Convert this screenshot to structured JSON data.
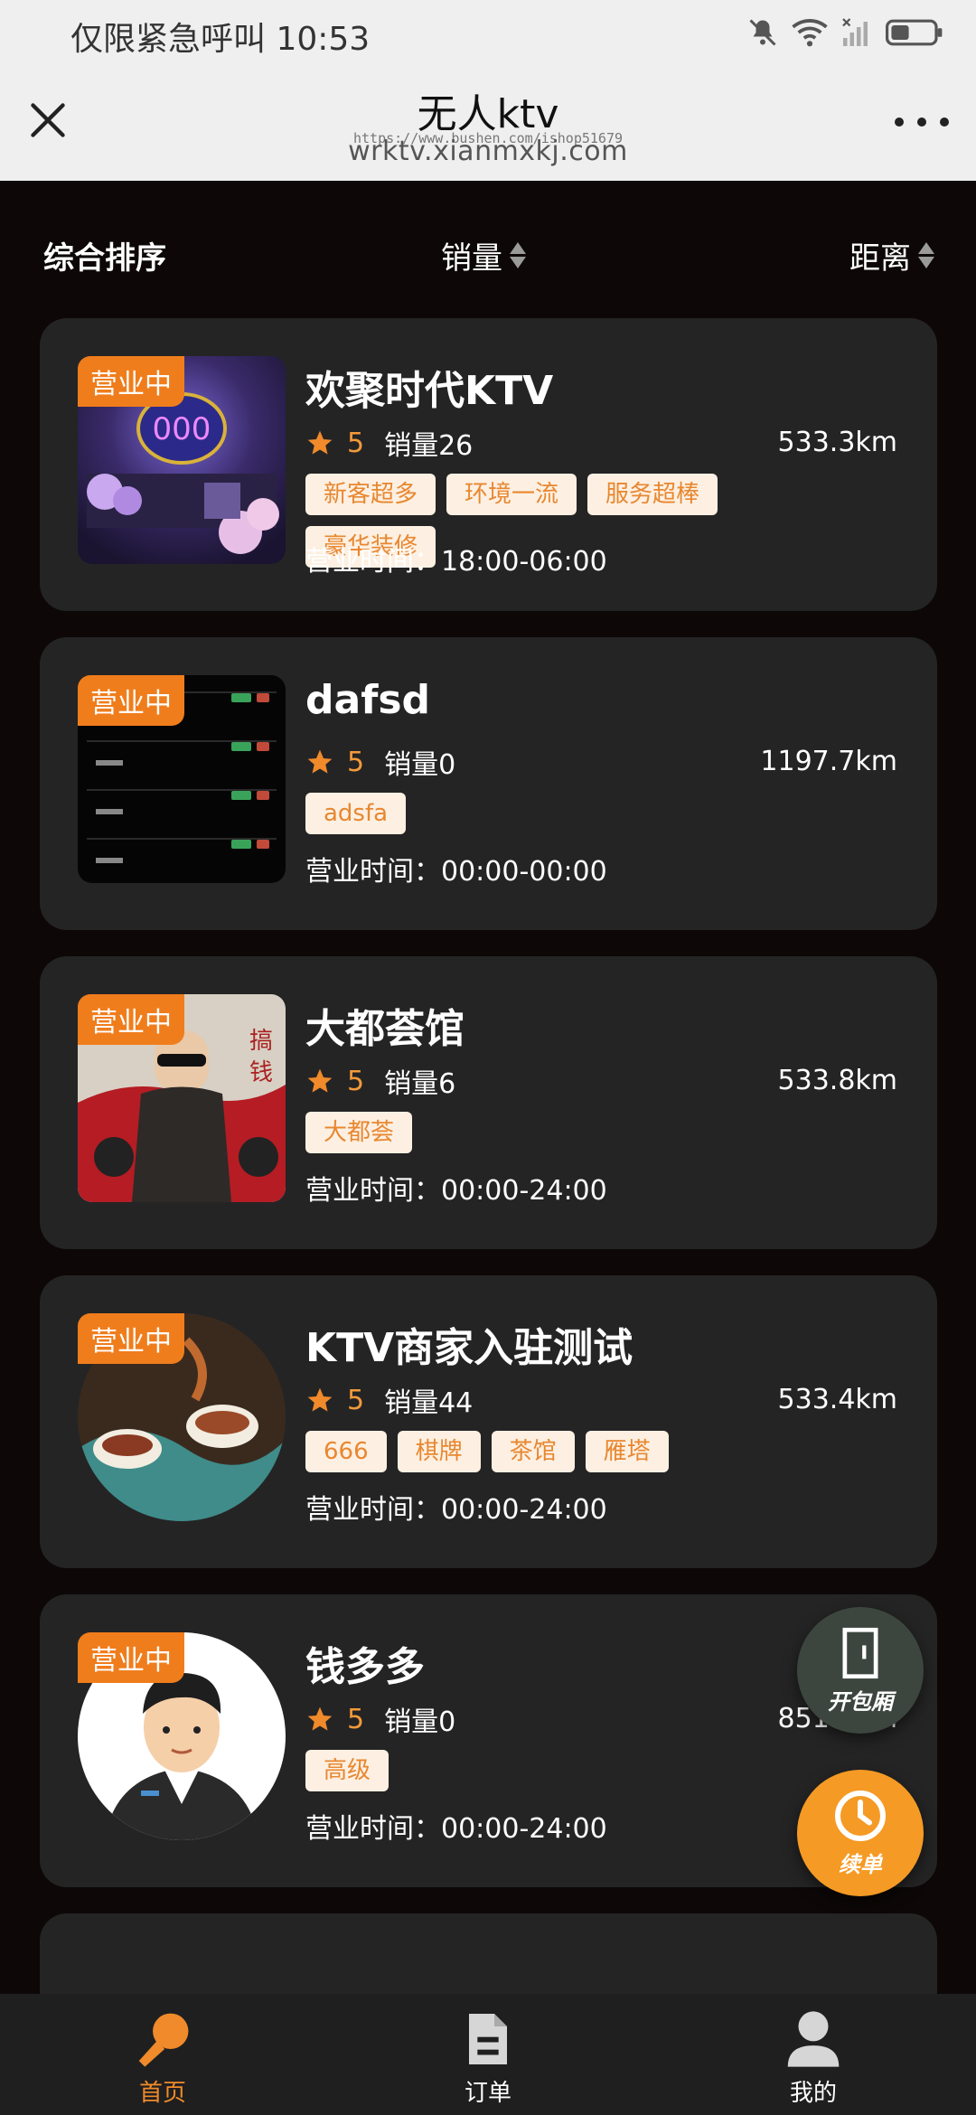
{
  "status_bar": {
    "left_text": "仅限紧急呼叫 10:53",
    "icons": [
      "bell-off-icon",
      "wifi-icon",
      "signal-icon",
      "battery-icon"
    ]
  },
  "header": {
    "title": "无人ktv",
    "watermark": "https://www.bushen.com/ishop51679",
    "url": "wrktv.xianmxkj.com",
    "close_icon": "close-icon",
    "more_icon": "more-icon"
  },
  "sort_bar": {
    "comprehensive": "综合排序",
    "sales": "销量",
    "distance": "距离"
  },
  "stores": [
    {
      "status": "营业中",
      "name": "欢聚时代KTV",
      "score": "5",
      "sales": "销量26",
      "distance": "533.3km",
      "tags": [
        "新客超多",
        "环境一流",
        "服务超棒",
        "豪华装修"
      ],
      "hours_label": "营业时间：",
      "hours": "18:00-06:00"
    },
    {
      "status": "营业中",
      "name": "dafsd",
      "score": "5",
      "sales": "销量0",
      "distance": "1197.7km",
      "tags": [
        "adsfa"
      ],
      "hours_label": "营业时间：",
      "hours": "00:00-00:00"
    },
    {
      "status": "营业中",
      "name": "大都荟馆",
      "score": "5",
      "sales": "销量6",
      "distance": "533.8km",
      "tags": [
        "大都荟"
      ],
      "hours_label": "营业时间：",
      "hours": "00:00-24:00"
    },
    {
      "status": "营业中",
      "name": "KTV商家入驻测试",
      "score": "5",
      "sales": "销量44",
      "distance": "533.4km",
      "tags": [
        "666",
        "棋牌",
        "茶馆",
        "雁塔"
      ],
      "hours_label": "营业时间：",
      "hours": "00:00-24:00"
    },
    {
      "status": "营业中",
      "name": "钱多多",
      "score": "5",
      "sales": "销量0",
      "distance": "851.7km",
      "tags": [
        "高级"
      ],
      "hours_label": "营业时间：",
      "hours": "00:00-24:00"
    }
  ],
  "fab": {
    "open_room": "开包厢",
    "renew": "续单"
  },
  "bottom_nav": [
    {
      "label": "首页",
      "icon": "microphone-icon",
      "active": true
    },
    {
      "label": "订单",
      "icon": "document-icon",
      "active": false
    },
    {
      "label": "我的",
      "icon": "user-icon",
      "active": false
    }
  ],
  "colors": {
    "accent": "#f07d1c",
    "background": "#0d0707",
    "card": "#242425",
    "tag_bg": "#fdf0e2",
    "tag_text": "#e88730"
  }
}
